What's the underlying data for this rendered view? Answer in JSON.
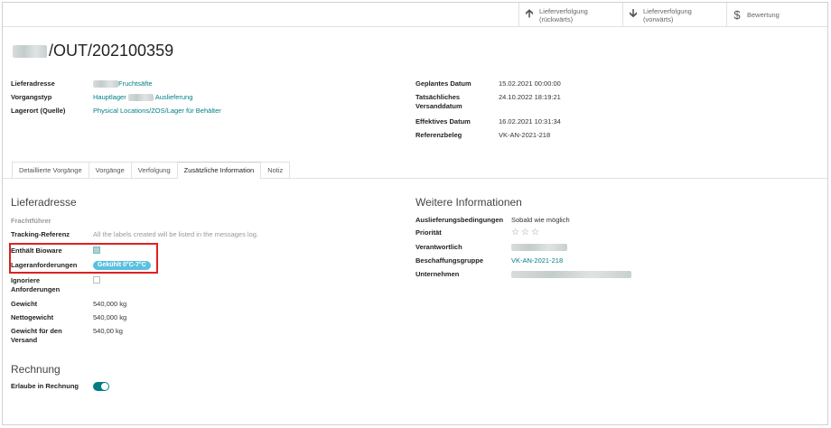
{
  "smart_buttons": [
    {
      "icon": "arrow-up-icon",
      "line1": "Lieferverfolgung",
      "line2": "(rückwärts)"
    },
    {
      "icon": "arrow-down-icon",
      "line1": "Lieferverfolgung",
      "line2": "(vorwärts)"
    },
    {
      "icon": "dollar-icon",
      "line1": "Bewertung",
      "line2": ""
    }
  ],
  "record": {
    "title": "/OUT/202100359"
  },
  "header_left": {
    "lieferadresse_label": "Lieferadresse",
    "lieferadresse_value": "Fruchtsäfte",
    "vorgangstyp_label": "Vorgangstyp",
    "vorgangstyp_value_1": "Hauptlager",
    "vorgangstyp_value_2": "Auslieferung",
    "lagerort_label": "Lagerort (Quelle)",
    "lagerort_value": "Physical Locations/ZOS/Lager für Behälter"
  },
  "header_right": {
    "geplantes_label": "Geplantes Datum",
    "geplantes_value": "15.02.2021 00:00:00",
    "tats_label_1": "Tatsächliches",
    "tats_label_2": "Versanddatum",
    "tats_value": "24.10.2022 18:19:21",
    "effektives_label": "Effektives Datum",
    "effektives_value": "16.02.2021 10:31:34",
    "referenz_label": "Referenzbeleg",
    "referenz_value": "VK-AN-2021-218"
  },
  "tabs": [
    {
      "label": "Detaillierte Vorgänge",
      "active": false
    },
    {
      "label": "Vorgänge",
      "active": false
    },
    {
      "label": "Verfolgung",
      "active": false
    },
    {
      "label": "Zusätzliche Information",
      "active": true
    },
    {
      "label": "Notiz",
      "active": false
    }
  ],
  "left_section": {
    "heading": "Lieferadresse",
    "frachtfuehrer_label": "Frachtführer",
    "tracking_label": "Tracking-Referenz",
    "tracking_placeholder": "All the labels created will be listed in the messages log.",
    "bioware_label": "Enthält Bioware",
    "bioware_checked": true,
    "lageranf_label": "Lageranforderungen",
    "lageranf_badge": "Gekühlt 0°C-7°C",
    "ignoriere_label_1": "Ignoriere",
    "ignoriere_label_2": "Anforderungen",
    "gewicht_label": "Gewicht",
    "gewicht_value": "540,000 kg",
    "netto_label": "Nettogewicht",
    "netto_value": "540,000 kg",
    "versand_label_1": "Gewicht für den",
    "versand_label_2": "Versand",
    "versand_value": "540,00 kg"
  },
  "rechnung_section": {
    "heading": "Rechnung",
    "erlaube_label": "Erlaube in Rechnung",
    "erlaube_on": true
  },
  "right_section": {
    "heading": "Weitere Informationen",
    "ausl_label": "Auslieferungsbedingungen",
    "ausl_value": "Sobald wie möglich",
    "prioritaet_label": "Priorität",
    "verantw_label": "Verantwortlich",
    "beschaffung_label": "Beschaffungsgruppe",
    "beschaffung_value": "VK-AN-2021-218",
    "unternehmen_label": "Unternehmen"
  },
  "colors": {
    "accent": "#017e84",
    "badge": "#5bc0de",
    "highlight": "#e02020"
  }
}
